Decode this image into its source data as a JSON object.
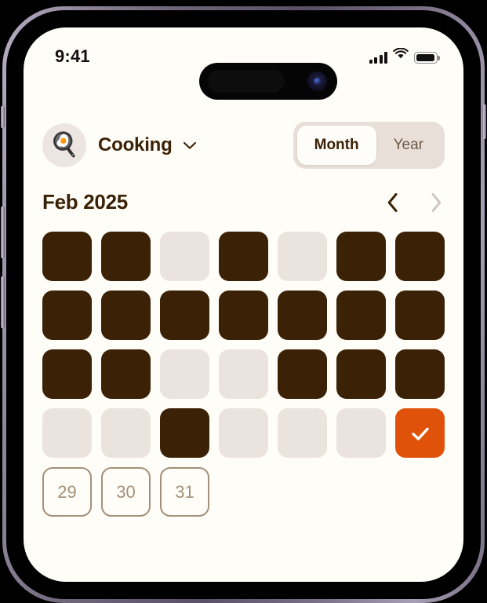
{
  "status_bar": {
    "time": "9:41",
    "cellular_icon": "cellular-bars-icon",
    "cellular_bars": 4,
    "wifi_icon": "wifi-icon",
    "battery_icon": "battery-full-icon",
    "battery_level": "100"
  },
  "header": {
    "habit_icon": "🍳",
    "habit_icon_name": "frying-pan-egg-icon",
    "habit_name": "Cooking",
    "habit_dropdown_icon": "chevron-down-icon",
    "period_segments": [
      {
        "label": "Month",
        "active": true
      },
      {
        "label": "Year",
        "active": false
      }
    ]
  },
  "month_nav": {
    "label": "Feb 2025",
    "prev_icon": "chevron-left-icon",
    "prev_enabled": true,
    "next_icon": "chevron-right-icon",
    "next_enabled": false
  },
  "grid": {
    "columns": 7,
    "cells": [
      {
        "state": "done",
        "label": ""
      },
      {
        "state": "done",
        "label": ""
      },
      {
        "state": "empty",
        "label": ""
      },
      {
        "state": "done",
        "label": ""
      },
      {
        "state": "empty",
        "label": ""
      },
      {
        "state": "done",
        "label": ""
      },
      {
        "state": "done",
        "label": ""
      },
      {
        "state": "done",
        "label": ""
      },
      {
        "state": "done",
        "label": ""
      },
      {
        "state": "done",
        "label": ""
      },
      {
        "state": "done",
        "label": ""
      },
      {
        "state": "done",
        "label": ""
      },
      {
        "state": "done",
        "label": ""
      },
      {
        "state": "done",
        "label": ""
      },
      {
        "state": "done",
        "label": ""
      },
      {
        "state": "done",
        "label": ""
      },
      {
        "state": "empty",
        "label": ""
      },
      {
        "state": "empty",
        "label": ""
      },
      {
        "state": "done",
        "label": ""
      },
      {
        "state": "done",
        "label": ""
      },
      {
        "state": "done",
        "label": ""
      },
      {
        "state": "empty",
        "label": ""
      },
      {
        "state": "empty",
        "label": ""
      },
      {
        "state": "done",
        "label": ""
      },
      {
        "state": "empty",
        "label": ""
      },
      {
        "state": "empty",
        "label": ""
      },
      {
        "state": "empty",
        "label": ""
      },
      {
        "state": "today",
        "label": "",
        "icon": "checkmark-icon"
      },
      {
        "state": "future",
        "label": "29"
      },
      {
        "state": "future",
        "label": "30"
      },
      {
        "state": "future",
        "label": "31"
      }
    ]
  },
  "colors": {
    "screen_background": "#FFFDF7",
    "cell_done": "#3B2106",
    "cell_empty": "#EBE3DD",
    "cell_today": "#E0520A",
    "cell_future_border": "#A3907A",
    "segment_track": "#E8DFD9",
    "segment_active": "#FFFDF9",
    "text_primary": "#3B2106",
    "text_muted": "#6D5A48"
  }
}
